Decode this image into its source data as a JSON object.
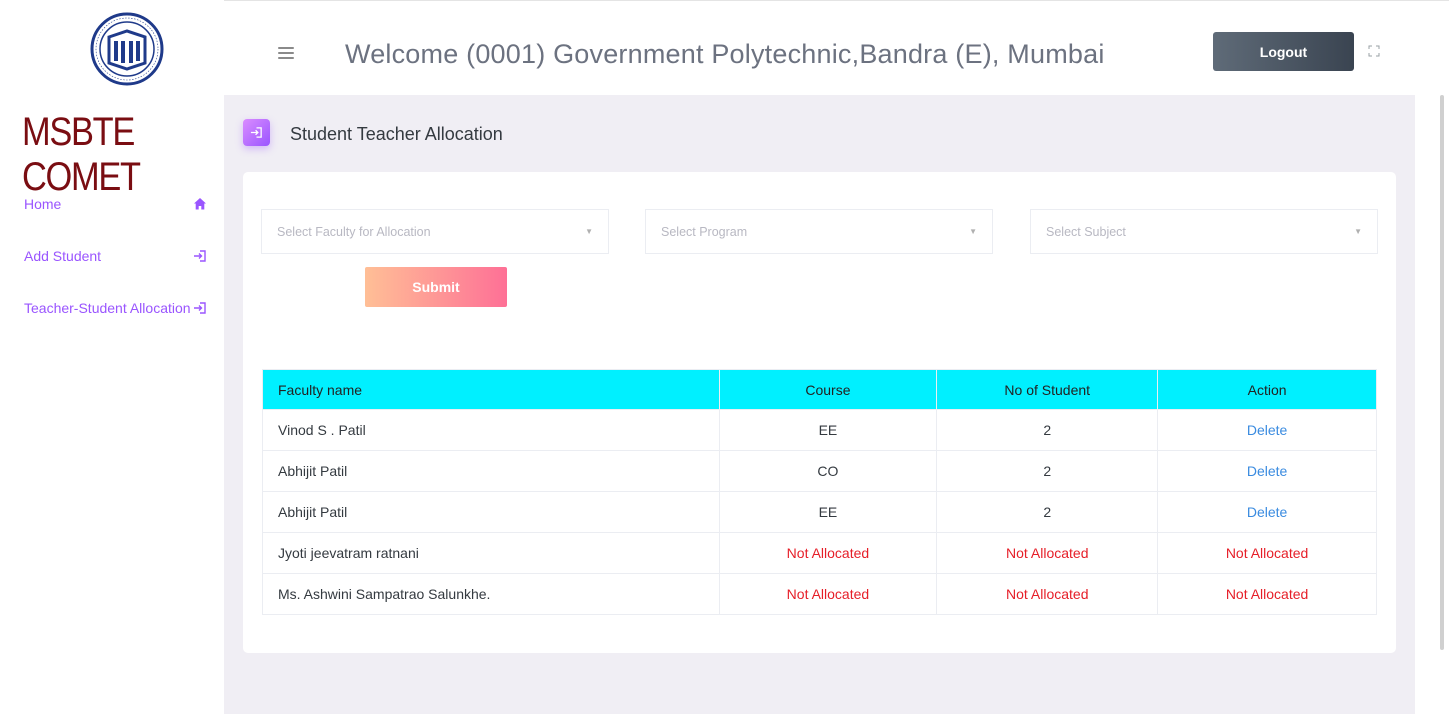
{
  "header": {
    "welcome": "Welcome (0001) Government Polytechnic,Bandra (E), Mumbai",
    "logout_label": "Logout"
  },
  "sidebar": {
    "brand": "MSBTE COMET",
    "items": [
      {
        "label": "Home",
        "icon": "home-icon"
      },
      {
        "label": "Add Student",
        "icon": "sign-in-icon"
      },
      {
        "label": "Teacher-Student Allocation",
        "icon": "sign-in-icon"
      }
    ]
  },
  "page": {
    "title": "Student Teacher Allocation",
    "selects": [
      {
        "placeholder": "Select Faculty for Allocation"
      },
      {
        "placeholder": "Select Program"
      },
      {
        "placeholder": "Select Subject"
      }
    ],
    "submit_label": "Submit"
  },
  "table": {
    "headers": [
      "Faculty name",
      "Course",
      "No of Student",
      "Action"
    ],
    "rows": [
      {
        "faculty": "Vinod S . Patil",
        "course": "EE",
        "count": "2",
        "action": "Delete"
      },
      {
        "faculty": "Abhijit Patil",
        "course": "CO",
        "count": "2",
        "action": "Delete"
      },
      {
        "faculty": "Abhijit Patil",
        "course": "EE",
        "count": "2",
        "action": "Delete"
      },
      {
        "faculty": "Jyoti jeevatram ratnani",
        "course": "Not Allocated",
        "count": "Not Allocated",
        "action": "Not Allocated"
      },
      {
        "faculty": "Ms. Ashwini Sampatrao Salunkhe.",
        "course": "Not Allocated",
        "count": "Not Allocated",
        "action": "Not Allocated"
      }
    ]
  },
  "colors": {
    "accent": "#9a55ff",
    "brand": "#7a0d12",
    "table_header": "#00f0ff",
    "link": "#3a8be0",
    "not_allocated": "#e61e28"
  }
}
